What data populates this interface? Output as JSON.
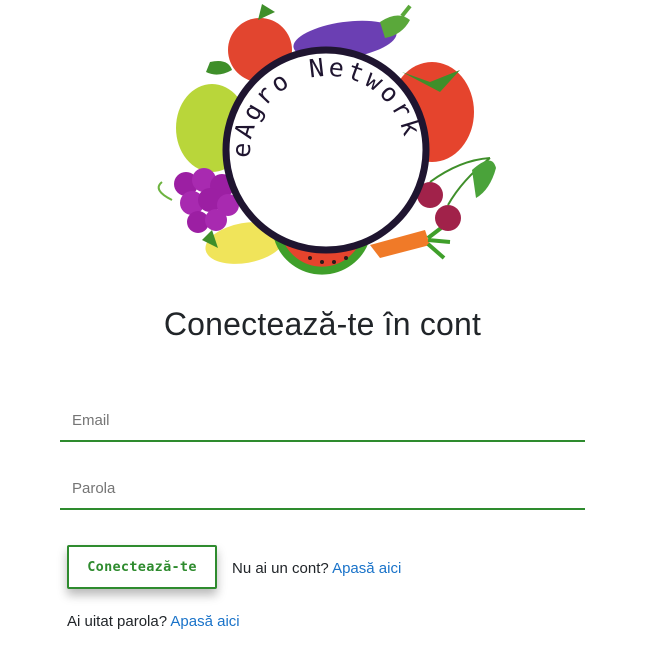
{
  "logo": {
    "text": "eAgro Network"
  },
  "page": {
    "title": "Conectează-te în cont"
  },
  "form": {
    "email_placeholder": "Email",
    "email_value": "",
    "password_placeholder": "Parola",
    "password_value": "",
    "submit_label": "Conectează-te"
  },
  "register": {
    "prompt": "Nu ai un cont?",
    "link_label": "Apasă aici"
  },
  "forgot": {
    "prompt": "Ai uitat parola?",
    "link_label": "Apasă aici"
  },
  "colors": {
    "accent_green": "#2e8b2e",
    "link_blue": "#1a73c9",
    "text_dark": "#212529"
  }
}
